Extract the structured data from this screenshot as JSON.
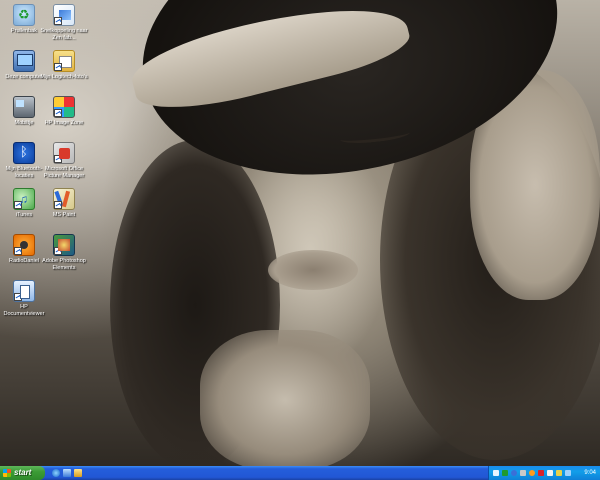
{
  "desktop": {
    "icons": [
      {
        "label": "Prullenbak"
      },
      {
        "label": "Snelkoppeling naar Zen fab..."
      },
      {
        "label": "Deze computer"
      },
      {
        "label": "Mijn Logitech-foto's"
      },
      {
        "label": "Mobiltje"
      },
      {
        "label": "HP Image Zone"
      },
      {
        "label": "Mijn Bluetooth-locaties"
      },
      {
        "label": "Microsoft Office Picture Manager"
      },
      {
        "label": "iTunes"
      },
      {
        "label": "MS Paint"
      },
      {
        "label": "RadioDaniel"
      },
      {
        "label": "Adobe Photoshop Elements"
      },
      {
        "label": "HP Documentviewer"
      }
    ]
  },
  "taskbar": {
    "start_label": "start",
    "clock": "9:04",
    "colors": {
      "bar": "#245edb",
      "start": "#3c9c36",
      "tray": "#129ee9"
    }
  }
}
